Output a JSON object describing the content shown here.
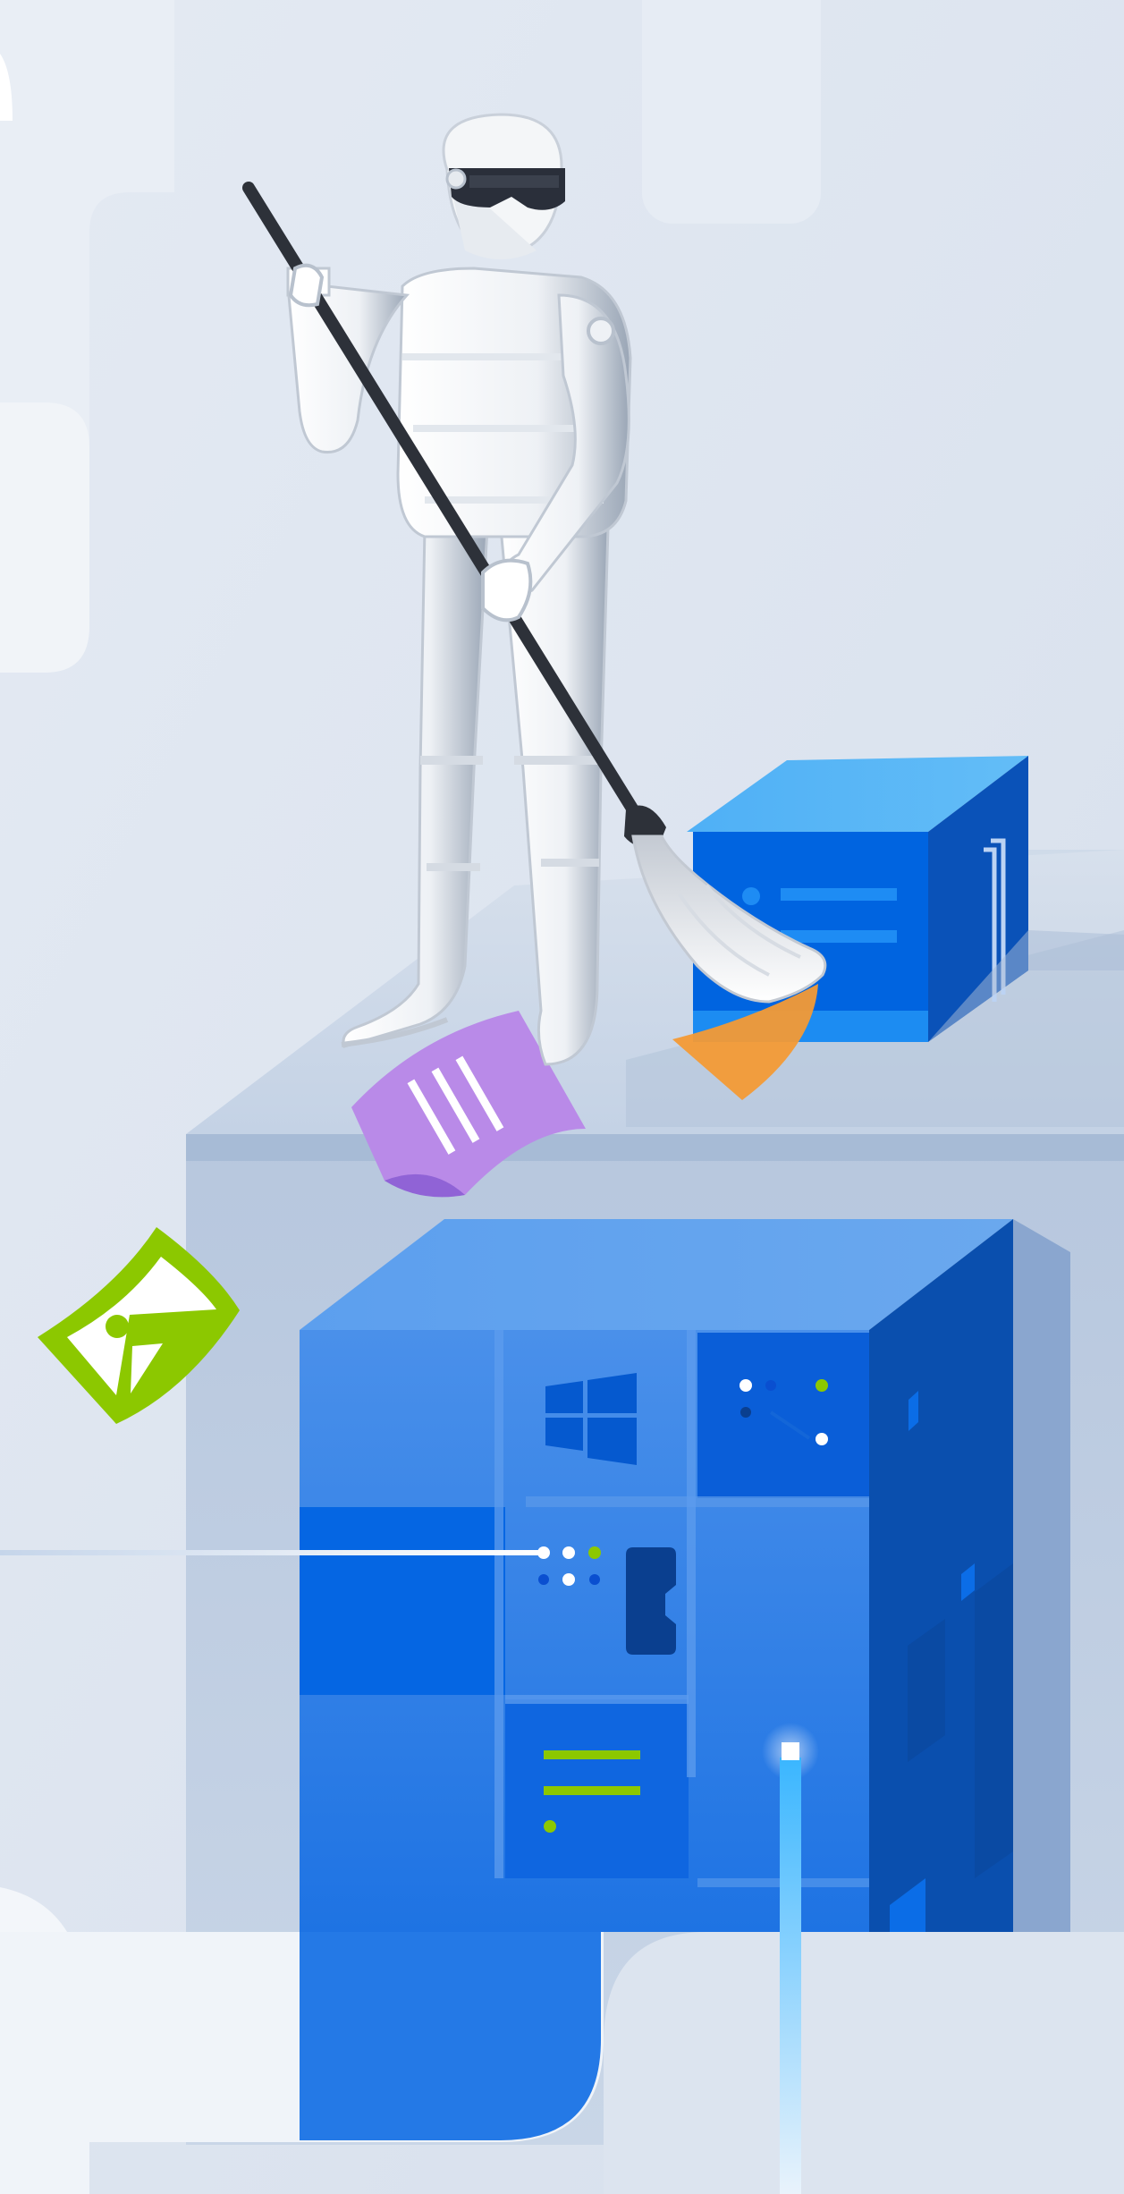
{
  "illustration": {
    "subject": "robot-sweeping-server-cleanup",
    "icons": [
      "windows-logo-icon",
      "image-file-icon",
      "document-file-icon",
      "broom-icon"
    ],
    "colors": {
      "background": "#dfe6f0",
      "server_blue": "#2a7be8",
      "server_dark": "#0050b0",
      "accent_green": "#8cc800",
      "file_purple": "#b98ae8",
      "file_orange": "#f39a35",
      "robot_white": "#f4f6f8",
      "visor": "#2a2f3a"
    }
  }
}
